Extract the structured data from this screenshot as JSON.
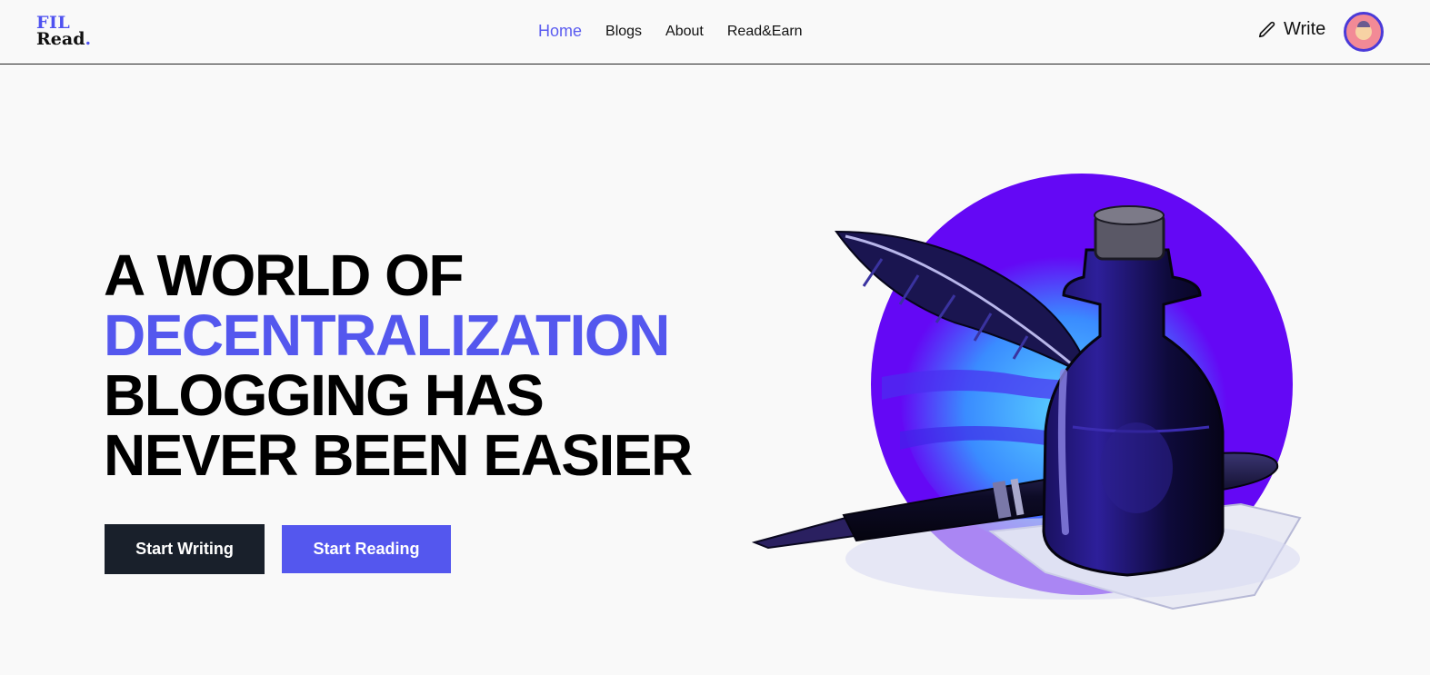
{
  "brand": {
    "line1": "FIL",
    "line2": "Read",
    "dot": "."
  },
  "nav": {
    "items": [
      {
        "label": "Home",
        "active": true
      },
      {
        "label": "Blogs",
        "active": false
      },
      {
        "label": "About",
        "active": false
      },
      {
        "label": "Read&Earn",
        "active": false
      }
    ]
  },
  "header": {
    "write_label": "Write"
  },
  "hero": {
    "line1": "A WORLD OF",
    "line2": "DECENTRALIZATION",
    "line3": "BLOGGING HAS",
    "line4": "NEVER BEEN EASIER"
  },
  "actions": {
    "start_writing": "Start Writing",
    "start_reading": "Start Reading"
  },
  "colors": {
    "accent": "#5457ee",
    "dark_button": "#19202b",
    "background": "#f9f9f9",
    "sun_purple": "#6408f5",
    "sun_blue": "#3aa8ff"
  },
  "icons": {
    "write": "pencil-icon",
    "avatar": "user-avatar",
    "hero": "ink-bottle-quill-illustration"
  }
}
